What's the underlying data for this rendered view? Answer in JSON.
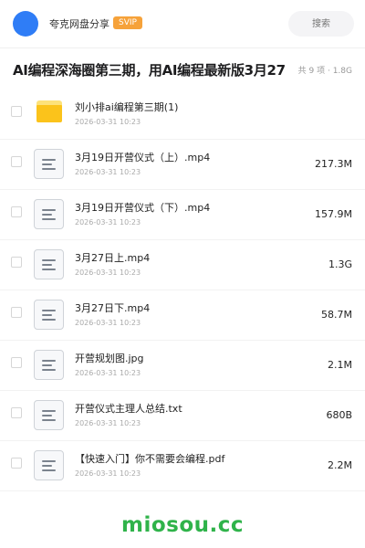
{
  "header": {
    "username": "夸克网盘分享",
    "vip_badge": "SVIP",
    "search_placeholder": "搜索"
  },
  "folder": {
    "title": "AI编程深海圈第三期，用AI编程最新版3月27",
    "meta": "共 9 项 · 1.8G"
  },
  "files": [
    {
      "name": "刘小排ai编程第三期(1)",
      "date": "2026-03-31 10:23",
      "size": "",
      "type": "folder"
    },
    {
      "name": "3月19日开营仪式（上）.mp4",
      "date": "2026-03-31 10:23",
      "size": "217.3M",
      "type": "file"
    },
    {
      "name": "3月19日开营仪式（下）.mp4",
      "date": "2026-03-31 10:23",
      "size": "157.9M",
      "type": "file"
    },
    {
      "name": "3月27日上.mp4",
      "date": "2026-03-31 10:23",
      "size": "1.3G",
      "type": "file"
    },
    {
      "name": "3月27日下.mp4",
      "date": "2026-03-31 10:23",
      "size": "58.7M",
      "type": "file"
    },
    {
      "name": "开营规划图.jpg",
      "date": "2026-03-31 10:23",
      "size": "2.1M",
      "type": "file"
    },
    {
      "name": "开营仪式主理人总结.txt",
      "date": "2026-03-31 10:23",
      "size": "680B",
      "type": "file"
    },
    {
      "name": "【快速入门】你不需要会编程.pdf",
      "date": "2026-03-31 10:23",
      "size": "2.2M",
      "type": "file"
    }
  ],
  "watermark": "miosou.cc",
  "colors": {
    "accent": "#2f7df6",
    "vip": "#f6a23a",
    "folder": "#fbc31b",
    "watermark": "#2fb34a"
  }
}
